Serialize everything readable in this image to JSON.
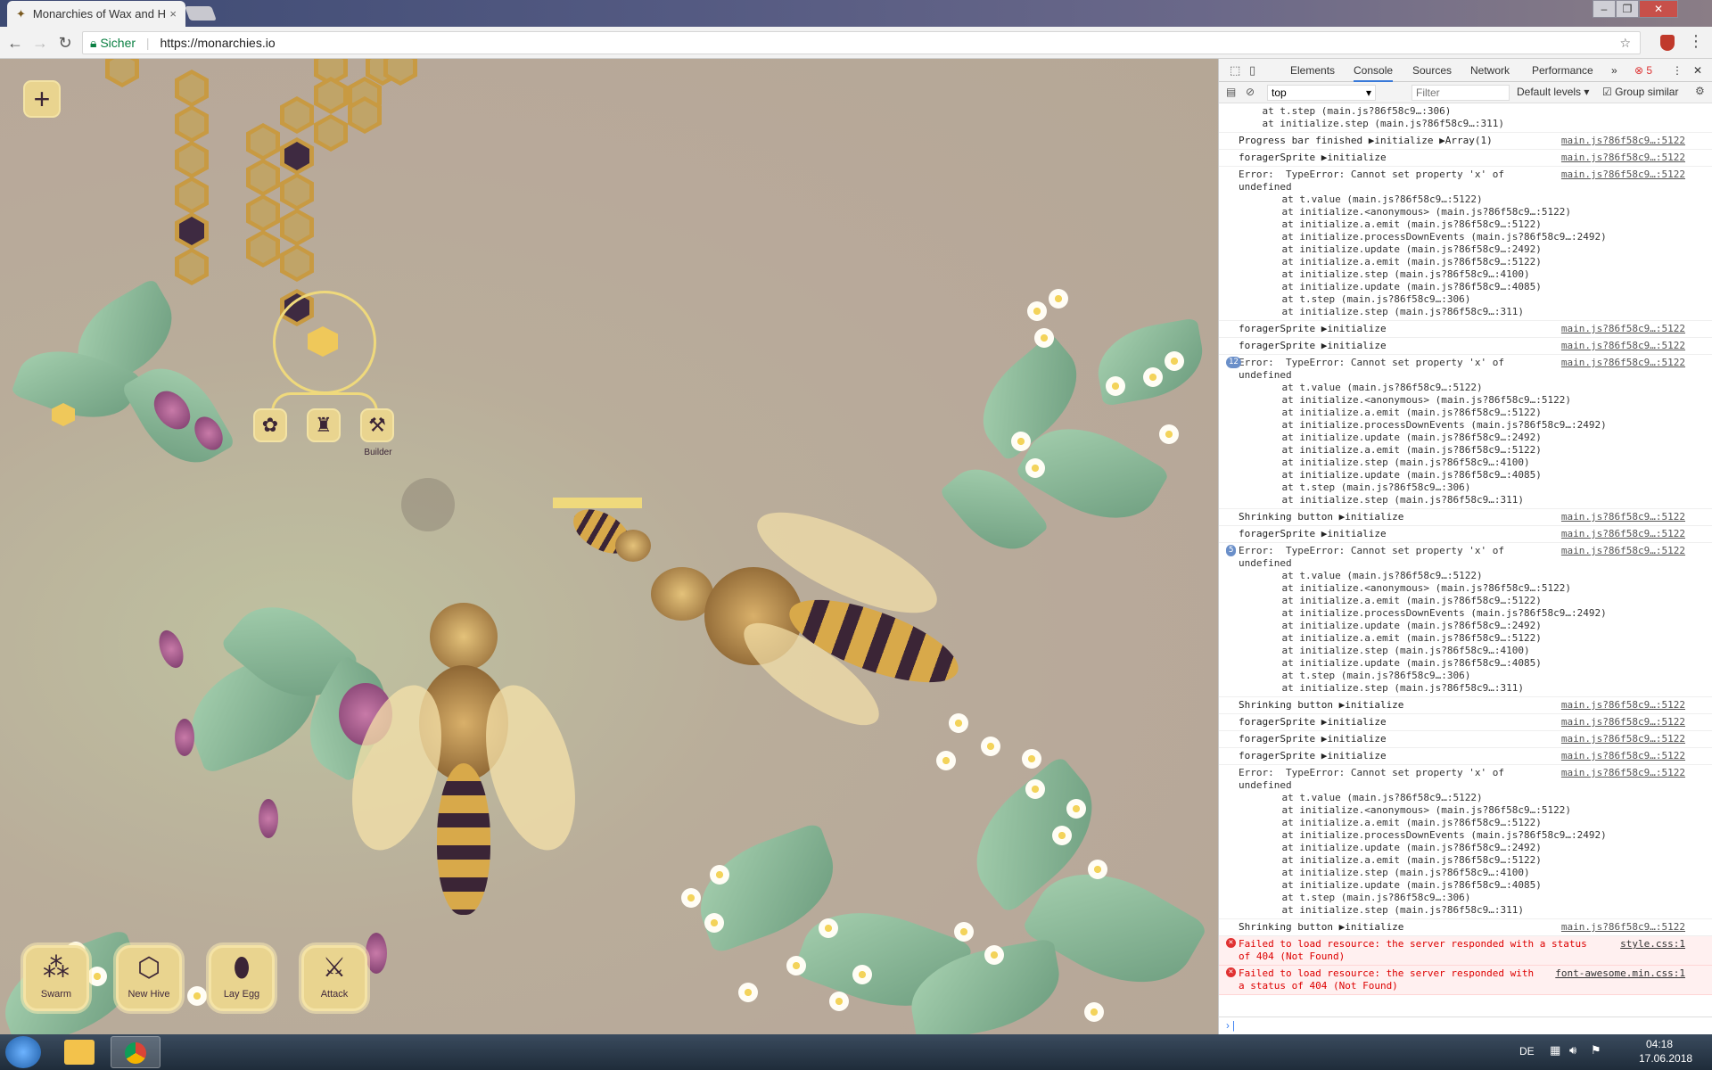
{
  "browser": {
    "tab_title": "Monarchies of Wax and H",
    "secure_label": "Sicher",
    "url": "https://monarchies.io",
    "window_buttons": [
      "–",
      "❐",
      "✕"
    ]
  },
  "game": {
    "side_button_label": "Builder",
    "actions": [
      {
        "label": "Swarm",
        "icon": "swarm-icon"
      },
      {
        "label": "New Hive",
        "icon": "hive-icon"
      },
      {
        "label": "Lay Egg",
        "icon": "egg-icon"
      },
      {
        "label": "Attack",
        "icon": "attack-icon"
      }
    ],
    "colors": {
      "honey": "#c89a42",
      "cell": "#c0a468",
      "dark_cell": "#3e2a41",
      "button": "#e9d48f"
    }
  },
  "devtools": {
    "tabs": [
      "Elements",
      "Console",
      "Sources",
      "Network",
      "Performance"
    ],
    "more": "»",
    "error_count": "5",
    "context": "top",
    "filter_placeholder": "Filter",
    "levels": "Default levels",
    "group_similar": "Group similar",
    "messages": [
      {
        "type": "stack",
        "lines": [
          "    at t.step (main.js?86f58c9…:306)",
          "    at initialize.step (main.js?86f58c9…:311)"
        ]
      },
      {
        "type": "log",
        "text": "Progress bar finished ▶initialize ▶Array(1)",
        "src": "main.js?86f58c9…:5122"
      },
      {
        "type": "log",
        "text": "foragerSprite ▶initialize",
        "src": "main.js?86f58c9…:5122"
      },
      {
        "type": "error",
        "text": "Error:  TypeError: Cannot set property 'x' of\nundefined",
        "src": "main.js?86f58c9…:5122",
        "stack": [
          "    at t.value (main.js?86f58c9…:5122)",
          "    at initialize.<anonymous> (main.js?86f58c9…:5122)",
          "    at initialize.a.emit (main.js?86f58c9…:5122)",
          "    at initialize.processDownEvents (main.js?86f58c9…:2492)",
          "    at initialize.update (main.js?86f58c9…:2492)",
          "    at initialize.a.emit (main.js?86f58c9…:5122)",
          "    at initialize.step (main.js?86f58c9…:4100)",
          "    at initialize.update (main.js?86f58c9…:4085)",
          "    at t.step (main.js?86f58c9…:306)",
          "    at initialize.step (main.js?86f58c9…:311)"
        ]
      },
      {
        "type": "log",
        "text": "foragerSprite ▶initialize",
        "src": "main.js?86f58c9…:5122"
      },
      {
        "type": "log",
        "text": "foragerSprite ▶initialize",
        "src": "main.js?86f58c9…:5122"
      },
      {
        "type": "error",
        "badge": "12",
        "text": "Error:  TypeError: Cannot set property 'x' of\nundefined",
        "src": "main.js?86f58c9…:5122",
        "stack": [
          "    at t.value (main.js?86f58c9…:5122)",
          "    at initialize.<anonymous> (main.js?86f58c9…:5122)",
          "    at initialize.a.emit (main.js?86f58c9…:5122)",
          "    at initialize.processDownEvents (main.js?86f58c9…:2492)",
          "    at initialize.update (main.js?86f58c9…:2492)",
          "    at initialize.a.emit (main.js?86f58c9…:5122)",
          "    at initialize.step (main.js?86f58c9…:4100)",
          "    at initialize.update (main.js?86f58c9…:4085)",
          "    at t.step (main.js?86f58c9…:306)",
          "    at initialize.step (main.js?86f58c9…:311)"
        ]
      },
      {
        "type": "log",
        "text": "Shrinking button ▶initialize",
        "src": "main.js?86f58c9…:5122"
      },
      {
        "type": "log",
        "text": "foragerSprite ▶initialize",
        "src": "main.js?86f58c9…:5122"
      },
      {
        "type": "error",
        "badge": "5",
        "text": "Error:  TypeError: Cannot set property 'x' of\nundefined",
        "src": "main.js?86f58c9…:5122",
        "stack": [
          "    at t.value (main.js?86f58c9…:5122)",
          "    at initialize.<anonymous> (main.js?86f58c9…:5122)",
          "    at initialize.a.emit (main.js?86f58c9…:5122)",
          "    at initialize.processDownEvents (main.js?86f58c9…:2492)",
          "    at initialize.update (main.js?86f58c9…:2492)",
          "    at initialize.a.emit (main.js?86f58c9…:5122)",
          "    at initialize.step (main.js?86f58c9…:4100)",
          "    at initialize.update (main.js?86f58c9…:4085)",
          "    at t.step (main.js?86f58c9…:306)",
          "    at initialize.step (main.js?86f58c9…:311)"
        ]
      },
      {
        "type": "log",
        "text": "Shrinking button ▶initialize",
        "src": "main.js?86f58c9…:5122"
      },
      {
        "type": "log",
        "text": "foragerSprite ▶initialize",
        "src": "main.js?86f58c9…:5122"
      },
      {
        "type": "log",
        "text": "foragerSprite ▶initialize",
        "src": "main.js?86f58c9…:5122"
      },
      {
        "type": "log",
        "text": "foragerSprite ▶initialize",
        "src": "main.js?86f58c9…:5122"
      },
      {
        "type": "error",
        "text": "Error:  TypeError: Cannot set property 'x' of\nundefined",
        "src": "main.js?86f58c9…:5122",
        "stack": [
          "    at t.value (main.js?86f58c9…:5122)",
          "    at initialize.<anonymous> (main.js?86f58c9…:5122)",
          "    at initialize.a.emit (main.js?86f58c9…:5122)",
          "    at initialize.processDownEvents (main.js?86f58c9…:2492)",
          "    at initialize.update (main.js?86f58c9…:2492)",
          "    at initialize.a.emit (main.js?86f58c9…:5122)",
          "    at initialize.step (main.js?86f58c9…:4100)",
          "    at initialize.update (main.js?86f58c9…:4085)",
          "    at t.step (main.js?86f58c9…:306)",
          "    at initialize.step (main.js?86f58c9…:311)"
        ]
      },
      {
        "type": "log",
        "text": "Shrinking button ▶initialize",
        "src": "main.js?86f58c9…:5122"
      },
      {
        "type": "fail",
        "text": "Failed to load resource: the server responded with a status\nof 404 (Not Found)",
        "src": "style.css:1"
      },
      {
        "type": "fail",
        "text": "Failed to load resource: the server responded with\na status of 404 (Not Found)",
        "src": "font-awesome.min.css:1"
      }
    ],
    "prompt": "›"
  },
  "taskbar": {
    "lang": "DE",
    "time": "04:18",
    "date": "17.06.2018"
  }
}
